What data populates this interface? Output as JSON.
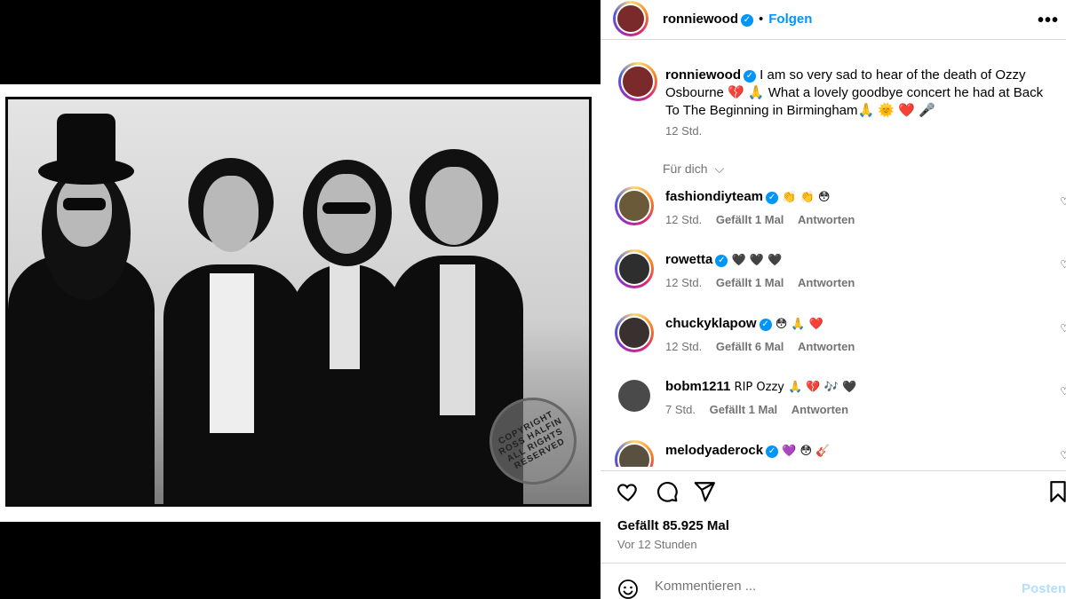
{
  "post": {
    "author": "ronniewood",
    "follow_label": "Folgen",
    "separator": "•",
    "more_icon": "more-horizontal-icon",
    "verified_mark": "✓",
    "caption": "I am so very sad to hear of the death of Ozzy Osbourne 💔 🙏 What a lovely goodbye concert he had at Back To The Beginning in Birmingham🙏 🌞 ❤️ 🎤",
    "caption_time": "12 Std.",
    "translate_label": "Für dich",
    "watermark": "COPYRIGHT ROSS HALFIN ALL RIGHTS RESERVED"
  },
  "comments": [
    {
      "user": "fashiondiyteam",
      "verified": true,
      "text": "👏 👏 😳",
      "time": "12 Std.",
      "likes": "Gefällt 1 Mal",
      "reply": "Antworten"
    },
    {
      "user": "rowetta",
      "verified": true,
      "text": "🖤 🖤 🖤",
      "time": "12 Std.",
      "likes": "Gefällt 1 Mal",
      "reply": "Antworten"
    },
    {
      "user": "chuckyklapow",
      "verified": true,
      "text": "😳 🙏 ❤️",
      "time": "12 Std.",
      "likes": "Gefällt 6 Mal",
      "reply": "Antworten"
    },
    {
      "user": "bobm1211",
      "verified": false,
      "text": "RIP Ozzy 🙏 💔 🎶 🖤",
      "time": "7 Std.",
      "likes": "Gefällt 1 Mal",
      "reply": "Antworten"
    },
    {
      "user": "melodyaderock",
      "verified": true,
      "text": "💜 😳 🎸",
      "time": "",
      "likes": "",
      "reply": ""
    }
  ],
  "engagement": {
    "likes": "Gefällt 85.925 Mal",
    "posted": "Vor 12 Stunden"
  },
  "composer": {
    "placeholder": "Kommentieren ...",
    "post_label": "Posten"
  },
  "colors": {
    "accent": "#0095f6",
    "muted": "#737373",
    "divider": "#dbdbdb"
  }
}
